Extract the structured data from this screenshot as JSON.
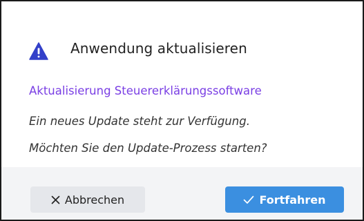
{
  "dialog": {
    "title": "Anwendung aktualisieren",
    "icon": "warning-triangle-icon",
    "subtitle": "Aktualisierung Steuererklärungssoftware",
    "message_lines": [
      "Ein neues Update steht zur Verfügung.",
      "Möchten Sie den Update-Prozess starten?"
    ]
  },
  "buttons": {
    "cancel_label": "Abbrechen",
    "cancel_icon": "close-icon",
    "continue_label": "Fortfahren",
    "continue_icon": "checkmark-icon"
  },
  "colors": {
    "accent_icon": "#3340c9",
    "subtitle": "#7a3fe4",
    "primary_button": "#3b8fe0",
    "secondary_button": "#e5e7eb",
    "footer_bg": "#f3f4f6"
  }
}
